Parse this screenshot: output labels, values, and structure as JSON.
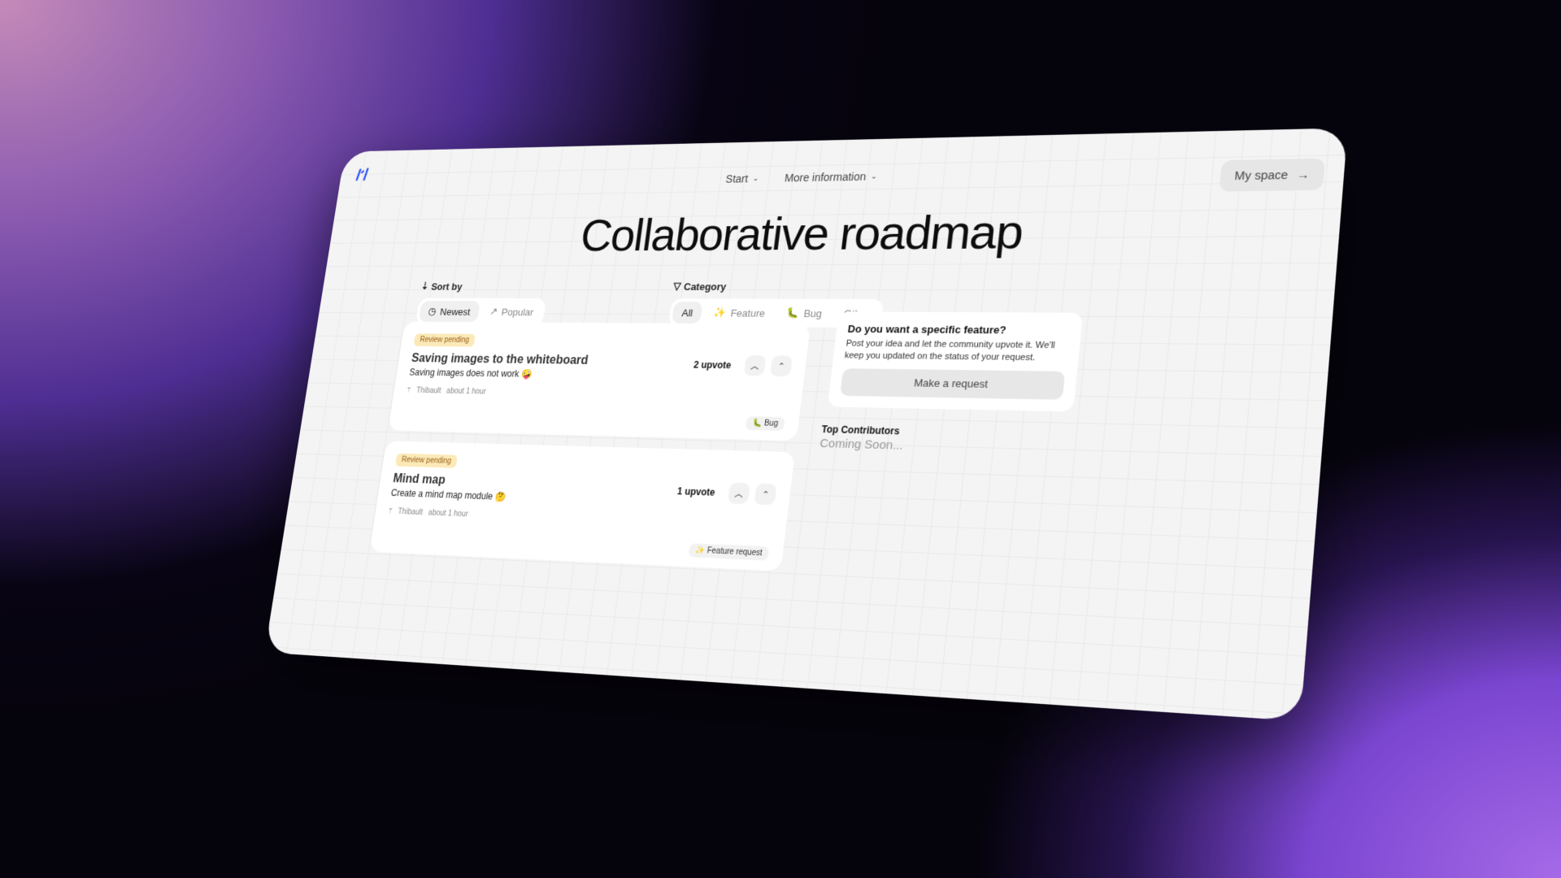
{
  "nav": {
    "items": [
      {
        "label": "Start",
        "icon": "chevron-down-icon"
      },
      {
        "label": "More information",
        "icon": "chevron-down-icon"
      }
    ],
    "my_space_label": "My space",
    "my_space_icon": "→"
  },
  "brand": {
    "accent": "#3b5bf5"
  },
  "page_title": "Collaborative roadmap",
  "sort": {
    "label": "Sort by",
    "options": [
      {
        "label": "Newest",
        "icon": "◷",
        "active": true
      },
      {
        "label": "Popular",
        "icon": "↗",
        "active": false
      }
    ]
  },
  "category": {
    "label": "Category",
    "options": [
      {
        "label": "All",
        "icon": "",
        "active": true
      },
      {
        "label": "Feature",
        "icon": "✨",
        "active": false
      },
      {
        "label": "Bug",
        "icon": "🐛",
        "active": false
      },
      {
        "label": "Other",
        "icon": "",
        "active": false
      }
    ]
  },
  "posts": [
    {
      "status": "Review pending",
      "title": "Saving images to the whiteboard",
      "description": "Saving images does not work 🤪",
      "author": "Thibault",
      "time": "about 1 hour",
      "upvotes": "2 upvote",
      "tag": "🐛 Bug"
    },
    {
      "status": "Review pending",
      "title": "Mind map",
      "description": "Create a mind map module 🤔",
      "author": "Thibault",
      "time": "about 1 hour",
      "upvotes": "1 upvote",
      "tag": "✨ Feature request"
    }
  ],
  "request_box": {
    "title": "Do you want a specific feature?",
    "text": "Post your idea and let the community upvote it. We'll keep you updated on the status of your request.",
    "button": "Make a request"
  },
  "contributors": {
    "title": "Top Contributors",
    "subtitle": "Coming Soon..."
  }
}
